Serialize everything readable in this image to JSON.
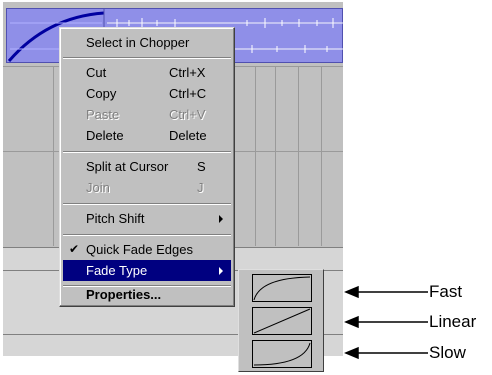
{
  "context_menu": {
    "items": [
      {
        "label": "Select in Chopper",
        "shortcut": ""
      },
      {
        "label": "Cut",
        "shortcut": "Ctrl+X"
      },
      {
        "label": "Copy",
        "shortcut": "Ctrl+C"
      },
      {
        "label": "Paste",
        "shortcut": "Ctrl+V",
        "disabled": true
      },
      {
        "label": "Delete",
        "shortcut": "Delete"
      },
      {
        "label": "Split at Cursor",
        "shortcut": "S"
      },
      {
        "label": "Join",
        "shortcut": "J",
        "disabled": true
      },
      {
        "label": "Pitch Shift",
        "shortcut": ""
      },
      {
        "label": "Quick Fade Edges",
        "shortcut": "",
        "checked": true
      },
      {
        "label": "Fade Type",
        "shortcut": "",
        "highlighted": true
      },
      {
        "label": "Properties...",
        "shortcut": ""
      }
    ]
  },
  "fade_types": [
    {
      "name": "Fast"
    },
    {
      "name": "Linear"
    },
    {
      "name": "Slow"
    }
  ],
  "colors": {
    "clip": "#8f8fe8",
    "highlight": "#000080",
    "menu_bg": "#c0c0c0"
  }
}
